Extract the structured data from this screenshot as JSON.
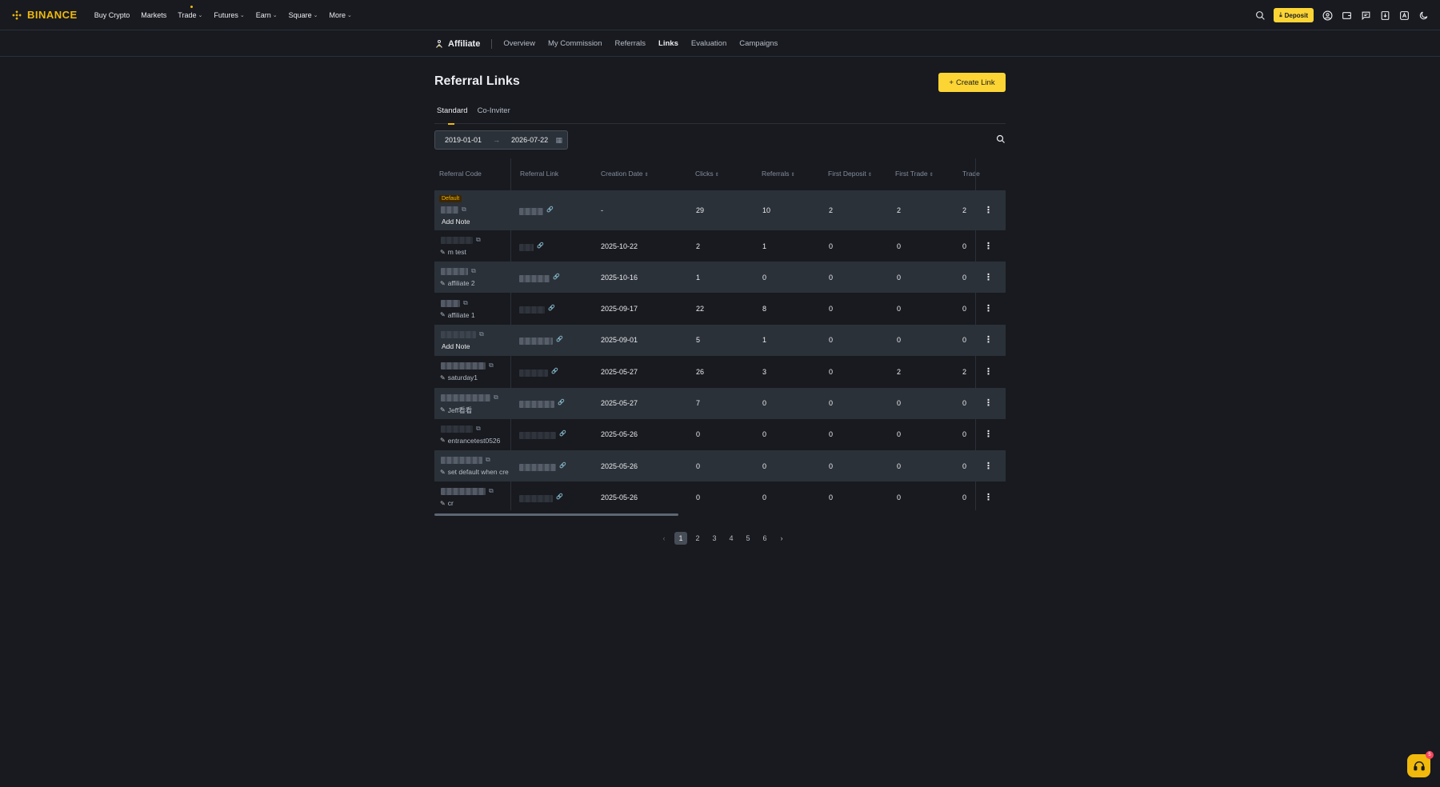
{
  "brand": {
    "name": "BINANCE",
    "accent": "#F0B90B"
  },
  "topnav": [
    {
      "label": "Buy Crypto",
      "chevron": false
    },
    {
      "label": "Markets",
      "chevron": false
    },
    {
      "label": "Trade",
      "chevron": true
    },
    {
      "label": "Futures",
      "chevron": true
    },
    {
      "label": "Earn",
      "chevron": true
    },
    {
      "label": "Square",
      "chevron": true
    },
    {
      "label": "More",
      "chevron": true
    }
  ],
  "header_right": {
    "deposit_label": "Deposit"
  },
  "affiliate": {
    "title": "Affiliate",
    "tabs": [
      "Overview",
      "My Commission",
      "Referrals",
      "Links",
      "Evaluation",
      "Campaigns"
    ],
    "active_tab": "Links"
  },
  "page": {
    "title": "Referral Links",
    "create_label": "Create Link",
    "tabs": [
      "Standard",
      "Co-Inviter"
    ],
    "active_tab": "Standard",
    "date_from": "2019-01-01",
    "date_to": "2026-07-22"
  },
  "table": {
    "columns": [
      "Referral Code",
      "Referral Link",
      "Creation Date",
      "Clicks",
      "Referrals",
      "First Deposit",
      "First Trade",
      "Trade"
    ],
    "default_badge": "Default",
    "rows": [
      {
        "note": "Add Note",
        "note_is_add": true,
        "default": true,
        "date": "-",
        "clicks": "29",
        "referrals": "10",
        "first_deposit": "2",
        "first_trade": "2",
        "trade": "2"
      },
      {
        "note": "m test",
        "note_is_add": false,
        "default": false,
        "date": "2025-10-22",
        "clicks": "2",
        "referrals": "1",
        "first_deposit": "0",
        "first_trade": "0",
        "trade": "0"
      },
      {
        "note": "affiliate 2",
        "note_is_add": false,
        "default": false,
        "date": "2025-10-16",
        "clicks": "1",
        "referrals": "0",
        "first_deposit": "0",
        "first_trade": "0",
        "trade": "0"
      },
      {
        "note": "affiliate 1",
        "note_is_add": false,
        "default": false,
        "date": "2025-09-17",
        "clicks": "22",
        "referrals": "8",
        "first_deposit": "0",
        "first_trade": "0",
        "trade": "0"
      },
      {
        "note": "Add Note",
        "note_is_add": true,
        "default": false,
        "date": "2025-09-01",
        "clicks": "5",
        "referrals": "1",
        "first_deposit": "0",
        "first_trade": "0",
        "trade": "0"
      },
      {
        "note": "saturday1",
        "note_is_add": false,
        "default": false,
        "date": "2025-05-27",
        "clicks": "26",
        "referrals": "3",
        "first_deposit": "0",
        "first_trade": "2",
        "trade": "2"
      },
      {
        "note": "Jeff看看",
        "note_is_add": false,
        "default": false,
        "date": "2025-05-27",
        "clicks": "7",
        "referrals": "0",
        "first_deposit": "0",
        "first_trade": "0",
        "trade": "0"
      },
      {
        "note": "entrancetest0526",
        "note_is_add": false,
        "default": false,
        "date": "2025-05-26",
        "clicks": "0",
        "referrals": "0",
        "first_deposit": "0",
        "first_trade": "0",
        "trade": "0"
      },
      {
        "note": "set default when cre",
        "note_is_add": false,
        "default": false,
        "date": "2025-05-26",
        "clicks": "0",
        "referrals": "0",
        "first_deposit": "0",
        "first_trade": "0",
        "trade": "0"
      },
      {
        "note": "cr",
        "note_is_add": false,
        "default": false,
        "date": "2025-05-26",
        "clicks": "0",
        "referrals": "0",
        "first_deposit": "0",
        "first_trade": "0",
        "trade": "0"
      }
    ]
  },
  "pagination": {
    "pages": [
      "1",
      "2",
      "3",
      "4",
      "5",
      "6"
    ],
    "current": "1"
  },
  "support": {
    "count": "5"
  }
}
